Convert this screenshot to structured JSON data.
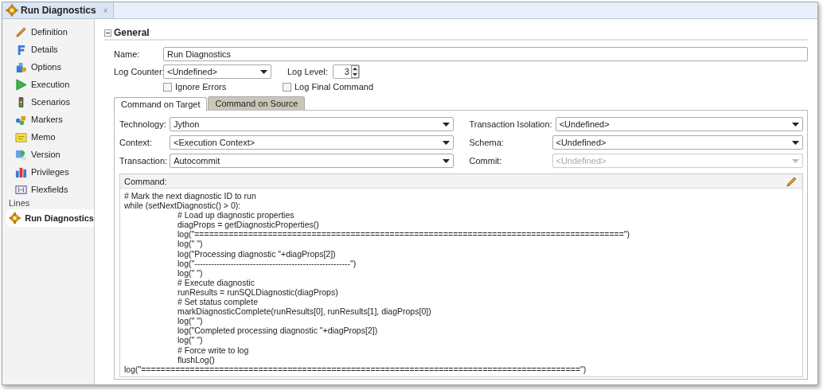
{
  "editor_tab": {
    "title": "Run Diagnostics",
    "close": "×"
  },
  "sidebar": {
    "items": [
      {
        "label": "Definition",
        "selected": false
      },
      {
        "label": "Details",
        "selected": false
      },
      {
        "label": "Options",
        "selected": false
      },
      {
        "label": "Execution",
        "selected": false
      },
      {
        "label": "Scenarios",
        "selected": false
      },
      {
        "label": "Markers",
        "selected": false
      },
      {
        "label": "Memo",
        "selected": false
      },
      {
        "label": "Version",
        "selected": false
      },
      {
        "label": "Privileges",
        "selected": false
      },
      {
        "label": "Flexfields",
        "selected": false
      }
    ],
    "section_label": "Lines",
    "lines": [
      {
        "label": "Run Diagnostics",
        "selected": true
      }
    ]
  },
  "general": {
    "title": "General",
    "expanded": true,
    "name": {
      "label": "Name:",
      "value": "Run Diagnostics"
    },
    "log_counter": {
      "label": "Log Counter:",
      "value": "<Undefined>"
    },
    "log_level": {
      "label": "Log Level:",
      "value": "3"
    },
    "ignore_errors": {
      "label": "Ignore Errors",
      "checked": false
    },
    "log_final_command": {
      "label": "Log Final Command",
      "checked": false
    }
  },
  "command_tabs": [
    {
      "label": "Command on Target",
      "selected": true
    },
    {
      "label": "Command on Source",
      "selected": false
    }
  ],
  "left_fields": [
    {
      "label": "Technology:",
      "value": "Jython",
      "disabled": false
    },
    {
      "label": "Context:",
      "value": "<Execution Context>",
      "disabled": false
    },
    {
      "label": "Transaction:",
      "value": "Autocommit",
      "disabled": false
    }
  ],
  "right_fields": [
    {
      "label": "Transaction Isolation:",
      "value": "<Undefined>",
      "disabled": false
    },
    {
      "label": "Schema:",
      "value": "<Undefined>",
      "disabled": false
    },
    {
      "label": "Commit:",
      "value": "<Undefined>",
      "disabled": true
    }
  ],
  "command": {
    "label": "Command:",
    "code": [
      {
        "text": "# Mark the next diagnostic ID to run"
      },
      {
        "text": "while (setNextDiagnostic() > 0):",
        "children": [
          {
            "text": "# Load up diagnostic properties"
          },
          {
            "text": "diagProps = getDiagnosticProperties()"
          },
          {
            "text": "log(\"========================================================================================\")"
          },
          {
            "text": "log(\" \")"
          },
          {
            "text": "log(\"Processing diagnostic \"+diagProps[2])"
          },
          {
            "text": "log(\"--------------------------------------------------------\")"
          },
          {
            "text": "log(\" \")"
          },
          {
            "text": "# Execute diagnostic"
          },
          {
            "text": "runResults = runSQLDiagnostic(diagProps)"
          },
          {
            "text": "# Set status complete"
          },
          {
            "text": "markDiagnosticComplete(runResults[0], runResults[1], diagProps[0])"
          },
          {
            "text": "log(\" \")"
          },
          {
            "text": "log(\"Completed processing diagnostic \"+diagProps[2])"
          },
          {
            "text": "log(\" \")"
          },
          {
            "text": "# Force write to log"
          },
          {
            "text": "flushLog()"
          }
        ]
      },
      {
        "text": "log(\"==========================================================================================\")"
      }
    ]
  }
}
